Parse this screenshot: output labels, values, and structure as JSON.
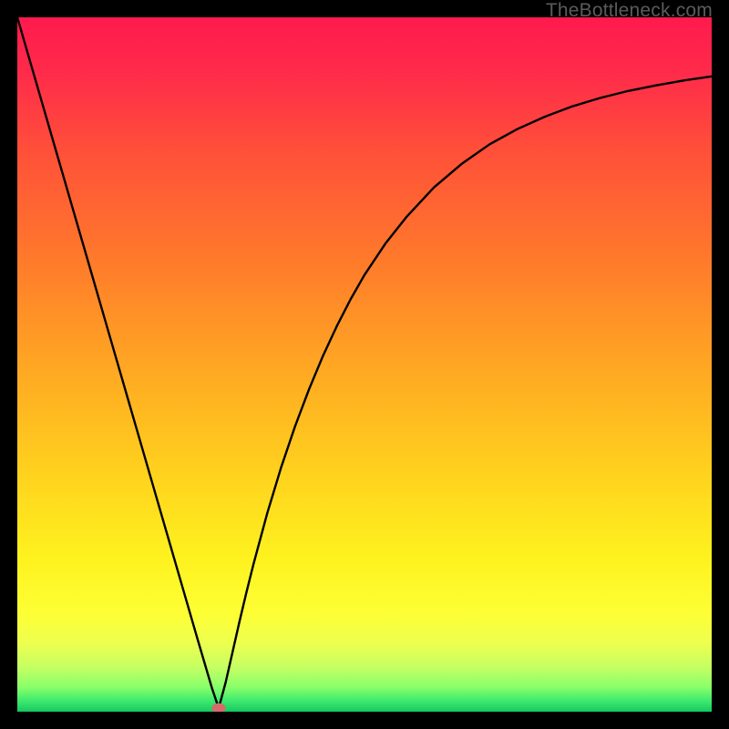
{
  "watermark": {
    "text": "TheBottleneck.com"
  },
  "chart_data": {
    "type": "line",
    "title": "",
    "xlabel": "",
    "ylabel": "",
    "xlim": [
      0,
      100
    ],
    "ylim": [
      0,
      100
    ],
    "x_min_at": 29,
    "series": [
      {
        "name": "bottleneck-curve",
        "x": [
          0,
          2,
          4,
          6,
          8,
          10,
          12,
          14,
          16,
          18,
          20,
          22,
          24,
          26,
          28,
          29,
          30,
          31,
          32,
          33,
          34,
          36,
          38,
          40,
          42,
          44,
          46,
          48,
          50,
          53,
          56,
          60,
          64,
          68,
          72,
          76,
          80,
          84,
          88,
          92,
          96,
          100
        ],
        "y": [
          100,
          93.1,
          86.2,
          79.3,
          72.4,
          65.5,
          58.6,
          51.7,
          44.8,
          37.9,
          31.0,
          24.1,
          17.2,
          10.3,
          3.5,
          0.5,
          4.2,
          8.6,
          13.0,
          17.2,
          21.2,
          28.6,
          35.2,
          41.1,
          46.4,
          51.2,
          55.5,
          59.4,
          62.9,
          67.4,
          71.2,
          75.5,
          78.9,
          81.7,
          83.9,
          85.7,
          87.2,
          88.4,
          89.4,
          90.2,
          90.9,
          91.5
        ]
      }
    ],
    "marker": {
      "x": 29,
      "y": 0.5
    },
    "gradient_stops": [
      {
        "offset": 0,
        "color": "#ff1a4d"
      },
      {
        "offset": 0.08,
        "color": "#ff2b4a"
      },
      {
        "offset": 0.2,
        "color": "#ff5238"
      },
      {
        "offset": 0.35,
        "color": "#ff7a2b"
      },
      {
        "offset": 0.5,
        "color": "#ffa623"
      },
      {
        "offset": 0.65,
        "color": "#ffd01e"
      },
      {
        "offset": 0.78,
        "color": "#fef21f"
      },
      {
        "offset": 0.86,
        "color": "#fdff35"
      },
      {
        "offset": 0.9,
        "color": "#eeff4e"
      },
      {
        "offset": 0.935,
        "color": "#c7ff62"
      },
      {
        "offset": 0.965,
        "color": "#88ff6a"
      },
      {
        "offset": 0.985,
        "color": "#3be86e"
      },
      {
        "offset": 1.0,
        "color": "#16c85f"
      }
    ]
  }
}
